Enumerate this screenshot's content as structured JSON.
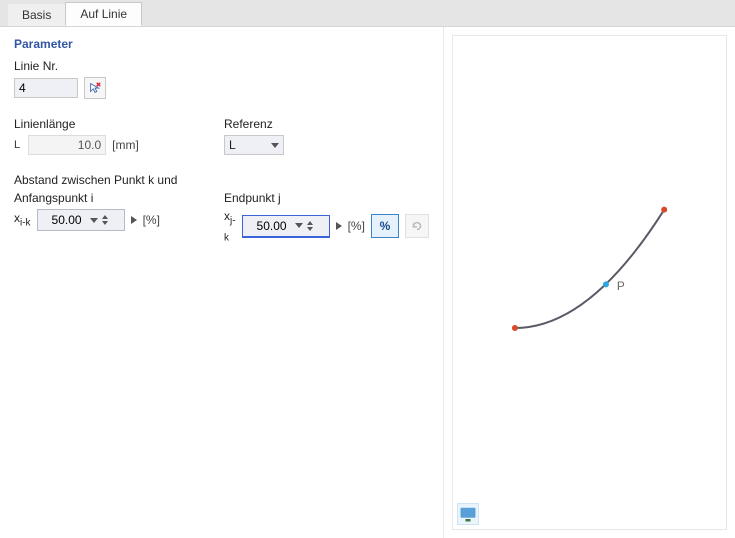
{
  "tabs": {
    "basis": "Basis",
    "aufLinie": "Auf Linie"
  },
  "panel": {
    "title": "Parameter",
    "linieNrLabel": "Linie Nr.",
    "linieNrValue": "4",
    "lenLabel": "Linienlänge",
    "lenSym": "L",
    "lenValue": "10.0",
    "lenUnit": "[mm]",
    "refLabel": "Referenz",
    "refValue": "L",
    "distHeader": "Abstand zwischen Punkt k und",
    "colI": "Anfangspunkt i",
    "colJ": "Endpunkt j",
    "symI": "x",
    "subI": "i-k",
    "valI": "50.00",
    "symJ": "x",
    "subJ": "j-k",
    "valJ": "50.00",
    "pct": "[%]",
    "pctBtn": "%"
  },
  "preview": {
    "pointLabel": "P"
  }
}
